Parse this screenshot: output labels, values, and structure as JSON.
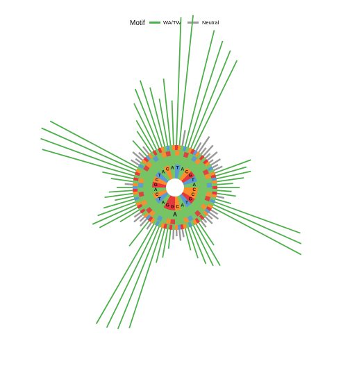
{
  "chart_data": {
    "type": "radial-bar",
    "legend": {
      "title": "Motif",
      "entries": [
        {
          "label": "WA/TW",
          "color": "#4daf4a"
        },
        {
          "label": "Neutral",
          "color": "#999999"
        }
      ],
      "placement": "top"
    },
    "colors": {
      "WA/TW": "#4daf4a",
      "Neutral": "#999999",
      "A": "#77c464",
      "C": "#ff8c2a",
      "G": "#e8363d",
      "T": "#5b9bd5"
    },
    "inner_ring": {
      "letters": [
        "T",
        "A",
        "C",
        "G",
        "T",
        "A",
        "C",
        "C",
        "G",
        "T",
        "A",
        "C",
        "G",
        "G",
        "A",
        "T",
        "C",
        "A",
        "G",
        "C",
        "T",
        "A",
        "C",
        "A"
      ],
      "highlight_letter": "A"
    },
    "bars": [
      {
        "angle": 2,
        "motif": "WA/TW",
        "value": 0.8
      },
      {
        "angle": 6,
        "motif": "WA/TW",
        "value": 0.82
      },
      {
        "angle": 10,
        "motif": "Neutral",
        "value": 0.1
      },
      {
        "angle": 14,
        "motif": "WA/TW",
        "value": 0.75
      },
      {
        "angle": 18,
        "motif": "WA/TW",
        "value": 0.7
      },
      {
        "angle": 22,
        "motif": "WA/TW",
        "value": 0.66
      },
      {
        "angle": 26,
        "motif": "WA/TW",
        "value": 0.62
      },
      {
        "angle": 30,
        "motif": "Neutral",
        "value": 0.06
      },
      {
        "angle": 34,
        "motif": "Neutral",
        "value": 0.12
      },
      {
        "angle": 38,
        "motif": "Neutral",
        "value": 0.05
      },
      {
        "angle": 42,
        "motif": "Neutral",
        "value": 0.09
      },
      {
        "angle": 46,
        "motif": "Neutral",
        "value": 0.04
      },
      {
        "angle": 50,
        "motif": "Neutral",
        "value": 0.08
      },
      {
        "angle": 54,
        "motif": "Neutral",
        "value": 0.03
      },
      {
        "angle": 58,
        "motif": "Neutral",
        "value": 0.07
      },
      {
        "angle": 62,
        "motif": "Neutral",
        "value": 0.04
      },
      {
        "angle": 66,
        "motif": "Neutral",
        "value": 0.06
      },
      {
        "angle": 70,
        "motif": "WA/TW",
        "value": 0.24
      },
      {
        "angle": 74,
        "motif": "WA/TW",
        "value": 0.2
      },
      {
        "angle": 78,
        "motif": "WA/TW",
        "value": 0.22
      },
      {
        "angle": 82,
        "motif": "WA/TW",
        "value": 0.17
      },
      {
        "angle": 86,
        "motif": "WA/TW",
        "value": 0.1
      },
      {
        "angle": 90,
        "motif": "WA/TW",
        "value": 0.14
      },
      {
        "angle": 94,
        "motif": "WA/TW",
        "value": 0.09
      },
      {
        "angle": 98,
        "motif": "WA/TW",
        "value": 0.12
      },
      {
        "angle": 102,
        "motif": "Neutral",
        "value": 0.05
      },
      {
        "angle": 106,
        "motif": "WA/TW",
        "value": 0.1
      },
      {
        "angle": 110,
        "motif": "WA/TW",
        "value": 0.57
      },
      {
        "angle": 114,
        "motif": "WA/TW",
        "value": 0.6
      },
      {
        "angle": 118,
        "motif": "WA/TW",
        "value": 0.63
      },
      {
        "angle": 122,
        "motif": "Neutral",
        "value": 0.05
      },
      {
        "angle": 126,
        "motif": "Neutral",
        "value": 0.07
      },
      {
        "angle": 130,
        "motif": "Neutral",
        "value": 0.04
      },
      {
        "angle": 134,
        "motif": "Neutral",
        "value": 0.06
      },
      {
        "angle": 138,
        "motif": "Neutral",
        "value": 0.03
      },
      {
        "angle": 142,
        "motif": "Neutral",
        "value": 0.05
      },
      {
        "angle": 146,
        "motif": "WA/TW",
        "value": 0.17
      },
      {
        "angle": 150,
        "motif": "WA/TW",
        "value": 0.3
      },
      {
        "angle": 154,
        "motif": "WA/TW",
        "value": 0.28
      },
      {
        "angle": 158,
        "motif": "WA/TW",
        "value": 0.25
      },
      {
        "angle": 162,
        "motif": "WA/TW",
        "value": 0.2
      },
      {
        "angle": 166,
        "motif": "WA/TW",
        "value": 0.14
      },
      {
        "angle": 170,
        "motif": "Neutral",
        "value": 0.05
      },
      {
        "angle": 174,
        "motif": "Neutral",
        "value": 0.07
      },
      {
        "angle": 178,
        "motif": "Neutral",
        "value": 0.04
      },
      {
        "angle": 182,
        "motif": "Neutral",
        "value": 0.06
      },
      {
        "angle": 186,
        "motif": "WA/TW",
        "value": 0.12
      },
      {
        "angle": 190,
        "motif": "WA/TW",
        "value": 0.18
      },
      {
        "angle": 194,
        "motif": "WA/TW",
        "value": 0.22
      },
      {
        "angle": 198,
        "motif": "WA/TW",
        "value": 0.66
      },
      {
        "angle": 202,
        "motif": "WA/TW",
        "value": 0.69
      },
      {
        "angle": 206,
        "motif": "WA/TW",
        "value": 0.71
      },
      {
        "angle": 210,
        "motif": "WA/TW",
        "value": 0.72
      },
      {
        "angle": 214,
        "motif": "Neutral",
        "value": 0.05
      },
      {
        "angle": 218,
        "motif": "WA/TW",
        "value": 0.2
      },
      {
        "angle": 222,
        "motif": "Neutral",
        "value": 0.06
      },
      {
        "angle": 226,
        "motif": "Neutral",
        "value": 0.04
      },
      {
        "angle": 230,
        "motif": "Neutral",
        "value": 0.07
      },
      {
        "angle": 234,
        "motif": "Neutral",
        "value": 0.05
      },
      {
        "angle": 238,
        "motif": "WA/TW",
        "value": 0.14
      },
      {
        "angle": 242,
        "motif": "WA/TW",
        "value": 0.27
      },
      {
        "angle": 246,
        "motif": "WA/TW",
        "value": 0.3
      },
      {
        "angle": 250,
        "motif": "WA/TW",
        "value": 0.25
      },
      {
        "angle": 254,
        "motif": "WA/TW",
        "value": 0.2
      },
      {
        "angle": 258,
        "motif": "WA/TW",
        "value": 0.12
      },
      {
        "angle": 262,
        "motif": "WA/TW",
        "value": 0.18
      },
      {
        "angle": 266,
        "motif": "WA/TW",
        "value": 0.15
      },
      {
        "angle": 270,
        "motif": "WA/TW",
        "value": 0.1
      },
      {
        "angle": 274,
        "motif": "Neutral",
        "value": 0.05
      },
      {
        "angle": 278,
        "motif": "WA/TW",
        "value": 0.14
      },
      {
        "angle": 282,
        "motif": "WA/TW",
        "value": 0.2
      },
      {
        "angle": 286,
        "motif": "WA/TW",
        "value": 0.6
      },
      {
        "angle": 290,
        "motif": "WA/TW",
        "value": 0.63
      },
      {
        "angle": 294,
        "motif": "WA/TW",
        "value": 0.65
      },
      {
        "angle": 298,
        "motif": "WA/TW",
        "value": 0.62
      },
      {
        "angle": 302,
        "motif": "Neutral",
        "value": 0.06
      },
      {
        "angle": 306,
        "motif": "Neutral",
        "value": 0.04
      },
      {
        "angle": 310,
        "motif": "Neutral",
        "value": 0.08
      },
      {
        "angle": 314,
        "motif": "Neutral",
        "value": 0.05
      },
      {
        "angle": 318,
        "motif": "WA/TW",
        "value": 0.13
      },
      {
        "angle": 322,
        "motif": "Neutral",
        "value": 0.06
      },
      {
        "angle": 326,
        "motif": "WA/TW",
        "value": 0.16
      },
      {
        "angle": 330,
        "motif": "WA/TW",
        "value": 0.22
      },
      {
        "angle": 334,
        "motif": "WA/TW",
        "value": 0.32
      },
      {
        "angle": 338,
        "motif": "WA/TW",
        "value": 0.4
      },
      {
        "angle": 342,
        "motif": "WA/TW",
        "value": 0.44
      },
      {
        "angle": 346,
        "motif": "WA/TW",
        "value": 0.38
      },
      {
        "angle": 350,
        "motif": "WA/TW",
        "value": 0.3
      },
      {
        "angle": 354,
        "motif": "WA/TW",
        "value": 0.42
      },
      {
        "angle": 358,
        "motif": "WA/TW",
        "value": 0.28
      }
    ]
  }
}
